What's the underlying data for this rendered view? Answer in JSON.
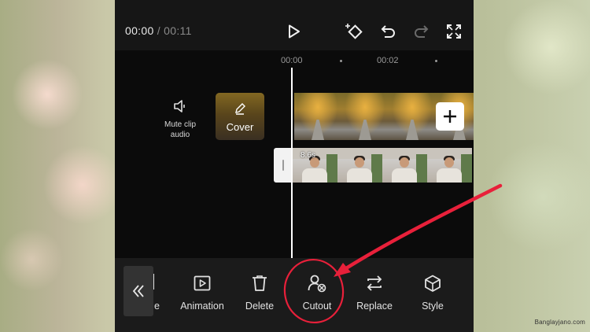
{
  "player": {
    "current_time": "00:00",
    "separator": "/",
    "total_time": "00:11",
    "icons": [
      "play-icon",
      "keyframe-icon",
      "undo-icon",
      "redo-icon",
      "fullscreen-icon"
    ]
  },
  "ruler": {
    "marks": [
      "00:00",
      "00:02"
    ]
  },
  "track": {
    "mute_label_line1": "Mute clip",
    "mute_label_line2": "audio",
    "cover_label": "Cover",
    "clip_duration": "8.6s"
  },
  "toolbar": {
    "partial_label": "e",
    "items": [
      {
        "label": "Animation",
        "icon": "animation-icon"
      },
      {
        "label": "Delete",
        "icon": "trash-icon"
      },
      {
        "label": "Cutout",
        "icon": "cutout-icon"
      },
      {
        "label": "Replace",
        "icon": "replace-icon"
      },
      {
        "label": "Style",
        "icon": "style-cube-icon"
      }
    ]
  },
  "annotation": {
    "color": "#e8203a",
    "highlighted_item": "Cutout"
  },
  "watermark": "Banglayjano.com",
  "colors": {
    "panel_bg": "#0b0b0b",
    "toolbar_bg": "#1b1b1b",
    "text": "#e2e2e2",
    "muted_text": "#8a8a8a"
  }
}
